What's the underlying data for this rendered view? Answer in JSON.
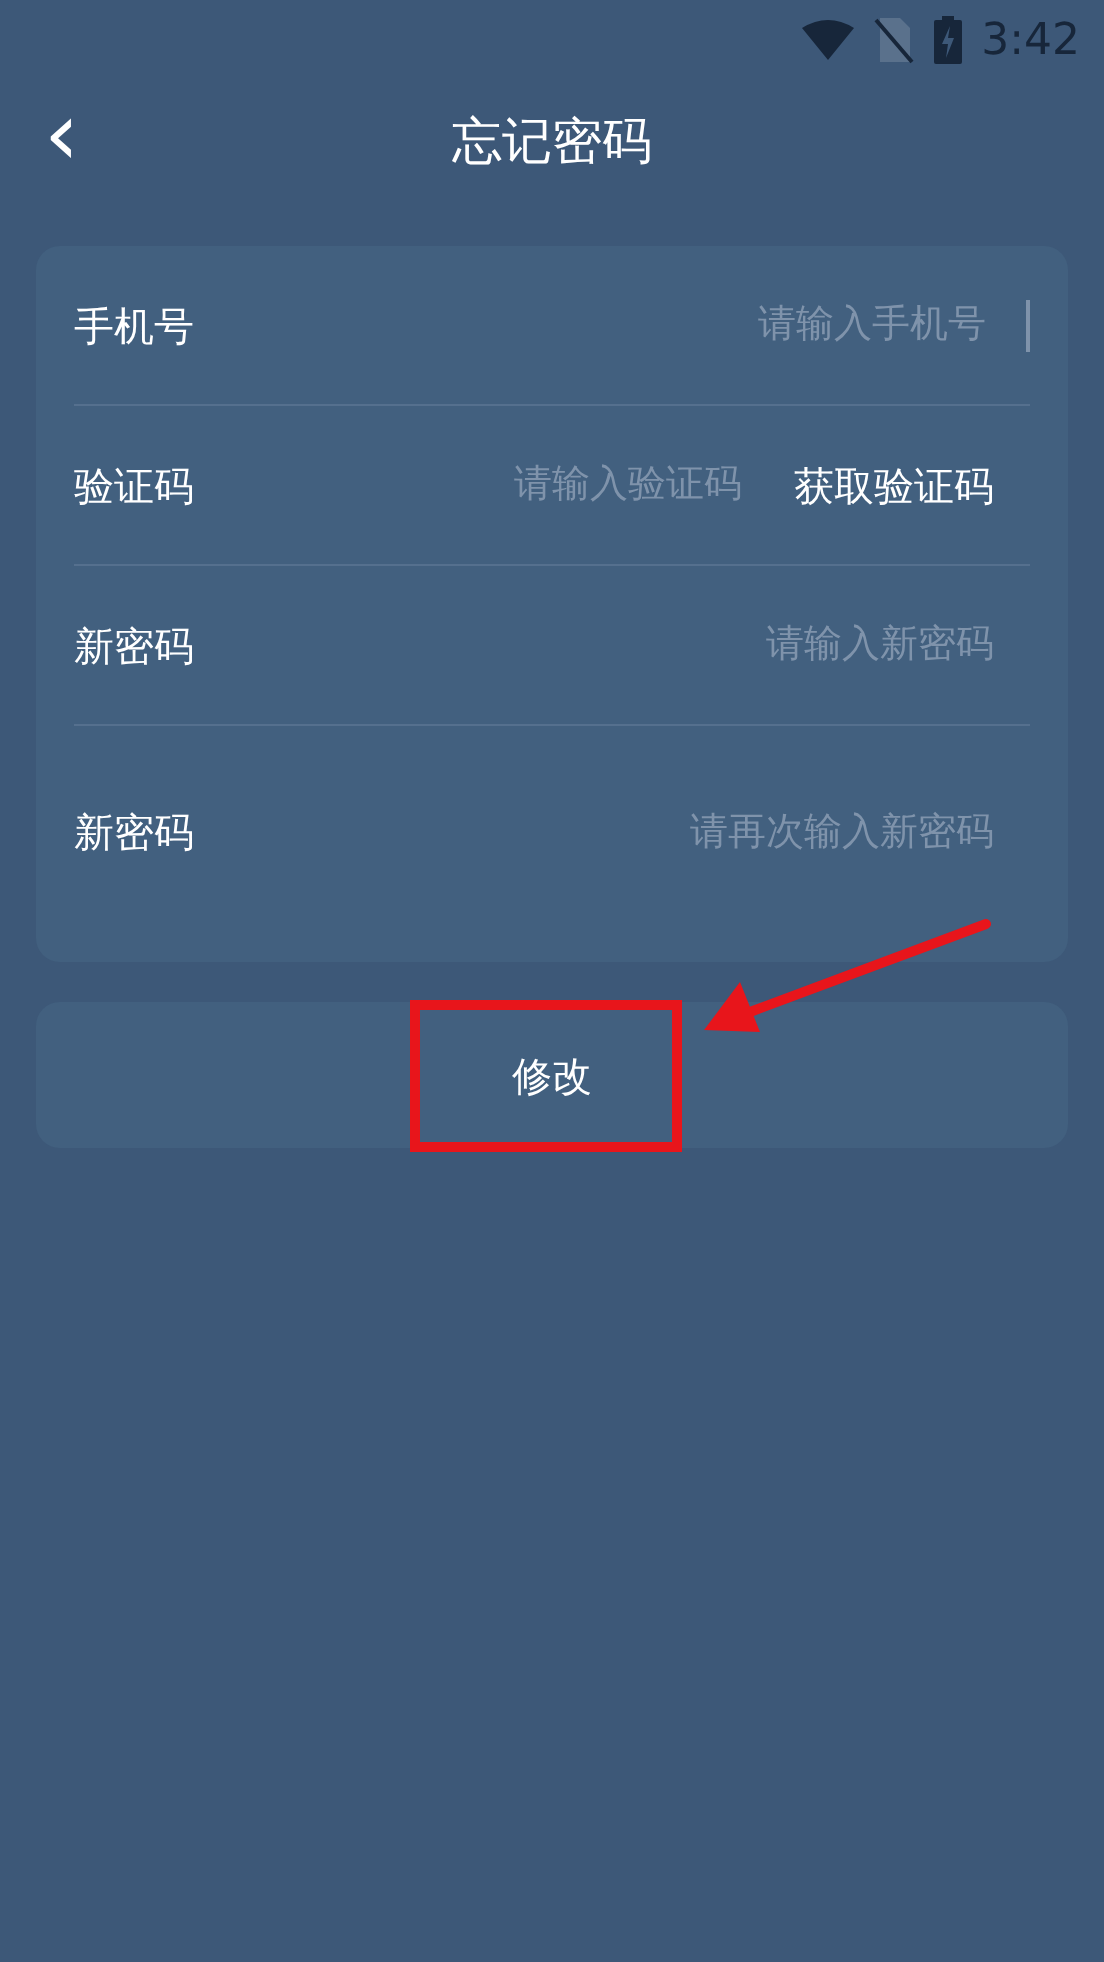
{
  "status_bar": {
    "time": "3:42"
  },
  "header": {
    "back": "‹",
    "title": "忘记密码"
  },
  "fields": [
    {
      "kind": "text",
      "label": "手机号",
      "placeholder": "请输入手机号",
      "focused": true
    },
    {
      "kind": "code",
      "label": "验证码",
      "placeholder": "请输入验证码",
      "focused": false,
      "action": "获取验证码"
    },
    {
      "kind": "text",
      "label": "新密码",
      "placeholder": "请输入新密码",
      "focused": false
    },
    {
      "kind": "text",
      "label": "新密码",
      "placeholder": "请再次输入新密码",
      "focused": false
    }
  ],
  "submit": {
    "label": "修改"
  },
  "annotations": {
    "highlight_box": true,
    "arrow": true
  }
}
